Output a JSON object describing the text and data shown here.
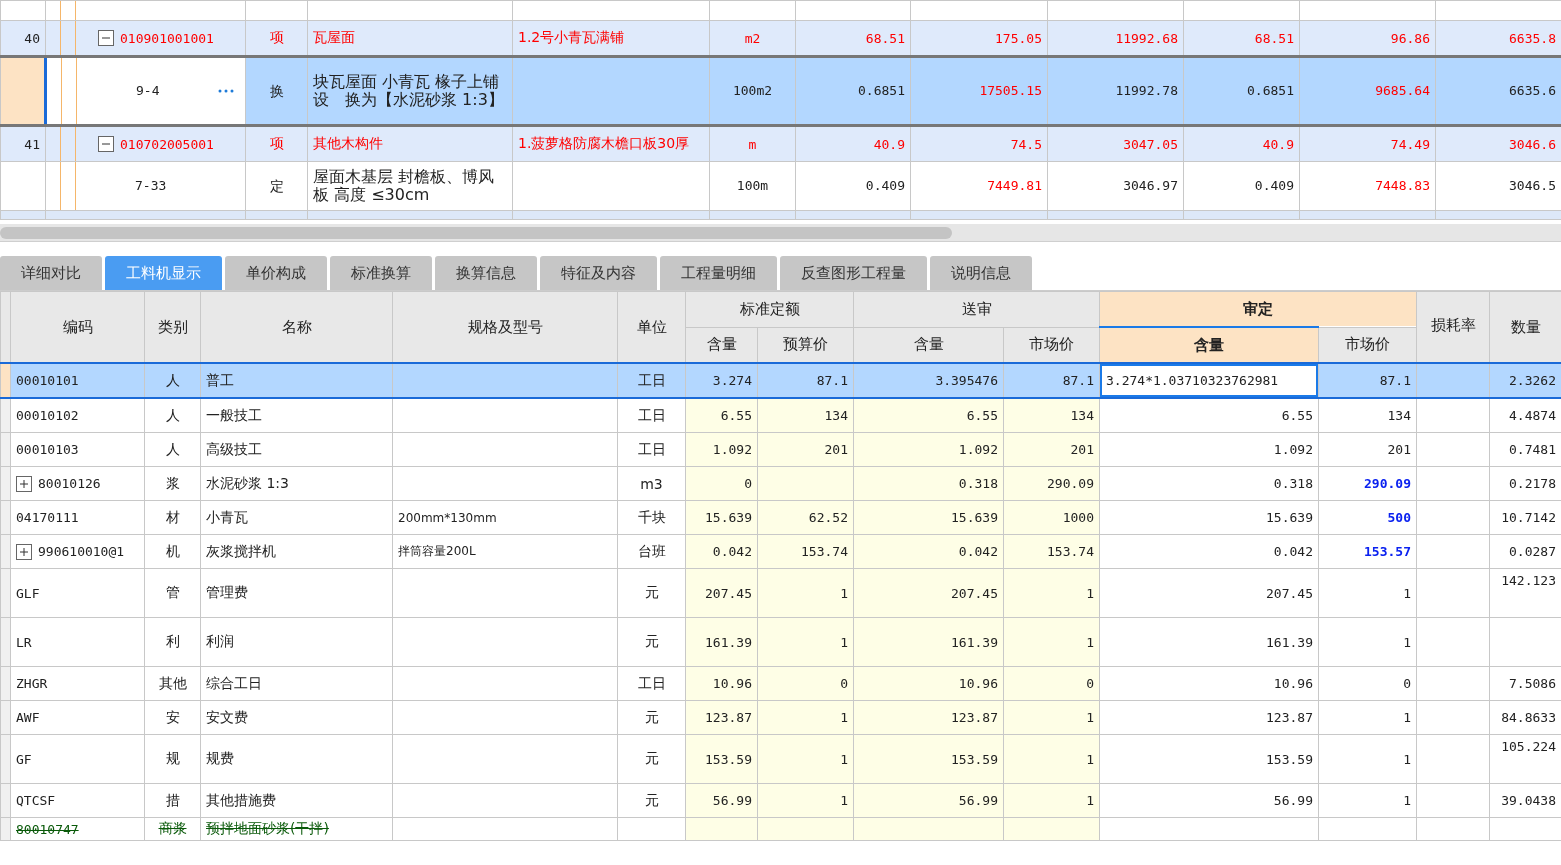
{
  "upper": {
    "rows": [
      {
        "kind": "item",
        "selected": false,
        "number": "40",
        "code": "010901001001",
        "expanded": true,
        "type": "项",
        "name": "瓦屋面",
        "feature": "1.2号小青瓦满铺",
        "unit": "m2",
        "values": [
          {
            "text": "68.51"
          },
          {
            "text": "175.05"
          },
          {
            "text": "11992.68"
          },
          {
            "text": "68.51"
          },
          {
            "text": "96.86"
          },
          {
            "text": "6635.8"
          }
        ]
      },
      {
        "kind": "quota",
        "selected": true,
        "code": "9-4",
        "type": "换",
        "name": "块瓦屋面 小青瓦 椽子上铺设　换为【水泥砂浆 1:3】",
        "unit": "100m2",
        "values": [
          {
            "text": "0.6851",
            "alert": false
          },
          {
            "text": "17505.15",
            "alert": true
          },
          {
            "text": "11992.78",
            "alert": false
          },
          {
            "text": "0.6851",
            "alert": false
          },
          {
            "text": "9685.64",
            "alert": true
          },
          {
            "text": "6635.6",
            "alert": false
          }
        ]
      },
      {
        "kind": "item",
        "selected": false,
        "number": "41",
        "code": "010702005001",
        "expanded": true,
        "type": "项",
        "name": "其他木构件",
        "feature": "1.菠萝格防腐木檐口板30厚",
        "unit": "m",
        "values": [
          {
            "text": "40.9"
          },
          {
            "text": "74.5"
          },
          {
            "text": "3047.05"
          },
          {
            "text": "40.9"
          },
          {
            "text": "74.49"
          },
          {
            "text": "3046.6"
          }
        ]
      },
      {
        "kind": "quota",
        "selected": false,
        "code": "7-33",
        "type": "定",
        "name": "屋面木基层 封檐板、博风板 高度 ≤30cm",
        "unit": "100m",
        "values": [
          {
            "text": "0.409",
            "alert": false
          },
          {
            "text": "7449.81",
            "alert": true
          },
          {
            "text": "3046.97",
            "alert": false
          },
          {
            "text": "0.409",
            "alert": false
          },
          {
            "text": "7448.83",
            "alert": true
          },
          {
            "text": "3046.5",
            "alert": false
          }
        ]
      }
    ]
  },
  "tabs": [
    {
      "label": "详细对比",
      "selected": false
    },
    {
      "label": "工料机显示",
      "selected": true
    },
    {
      "label": "单价构成",
      "selected": false
    },
    {
      "label": "标准换算",
      "selected": false
    },
    {
      "label": "换算信息",
      "selected": false
    },
    {
      "label": "特征及内容",
      "selected": false
    },
    {
      "label": "工程量明细",
      "selected": false
    },
    {
      "label": "反查图形工程量",
      "selected": false
    },
    {
      "label": "说明信息",
      "selected": false
    }
  ],
  "resources": {
    "headers": {
      "code": "编码",
      "category": "类别",
      "name": "名称",
      "spec": "规格及型号",
      "unit": "单位",
      "standard": "标准定额",
      "submitted": "送审",
      "approved": "审定",
      "std_quantity": "含量",
      "std_budget_price": "预算价",
      "sub_quantity": "含量",
      "sub_market_price": "市场价",
      "app_quantity": "含量",
      "app_market_price": "市场价",
      "loss_rate": "损耗率",
      "amount": "数量"
    },
    "rows": [
      {
        "kind": "normal",
        "selected": true,
        "code": "00010101",
        "category": "人",
        "name": "普工",
        "unit": "工日",
        "std_qty": "3.274",
        "std_price": "87.1",
        "sub_qty": "3.395476",
        "sub_price": "87.1",
        "app_qty": "3.274*1.03710323762981",
        "editing": true,
        "app_price": "87.1",
        "adjusted": false,
        "amount": "2.3262",
        "tall": false
      },
      {
        "kind": "normal",
        "selected": false,
        "code": "00010102",
        "category": "人",
        "name": "一般技工",
        "unit": "工日",
        "std_qty": "6.55",
        "std_price": "134",
        "sub_qty": "6.55",
        "sub_price": "134",
        "app_qty": "6.55",
        "editing": false,
        "app_price": "134",
        "adjusted": false,
        "amount": "4.4874",
        "tall": false
      },
      {
        "kind": "normal",
        "selected": false,
        "code": "00010103",
        "category": "人",
        "name": "高级技工",
        "unit": "工日",
        "std_qty": "1.092",
        "std_price": "201",
        "sub_qty": "1.092",
        "sub_price": "201",
        "app_qty": "1.092",
        "editing": false,
        "app_price": "201",
        "adjusted": false,
        "amount": "0.7481",
        "tall": false
      },
      {
        "kind": "normal",
        "selected": false,
        "expandable": true,
        "code": "80010126",
        "category": "浆",
        "name": "水泥砂浆 1:3",
        "unit": "m3",
        "std_qty": "0",
        "sub_qty": "0.318",
        "sub_price": "290.09",
        "app_qty": "0.318",
        "editing": false,
        "app_price": "290.09",
        "adjusted": true,
        "amount": "0.2178",
        "tall": false
      },
      {
        "kind": "normal",
        "selected": false,
        "code": "04170111",
        "category": "材",
        "name": "小青瓦",
        "spec": "200mm*130mm",
        "unit": "千块",
        "std_qty": "15.639",
        "std_price": "62.52",
        "sub_qty": "15.639",
        "sub_price": "1000",
        "app_qty": "15.639",
        "editing": false,
        "app_price": "500",
        "adjusted": true,
        "amount": "10.7142",
        "tall": false
      },
      {
        "kind": "normal",
        "selected": false,
        "expandable": true,
        "code": "990610010@1",
        "category": "机",
        "name": "灰浆搅拌机",
        "spec": "拌筒容量200L",
        "unit": "台班",
        "std_qty": "0.042",
        "std_price": "153.74",
        "sub_qty": "0.042",
        "sub_price": "153.74",
        "app_qty": "0.042",
        "editing": false,
        "app_price": "153.57",
        "adjusted": true,
        "amount": "0.0287",
        "tall": false
      },
      {
        "kind": "normal",
        "selected": false,
        "code": "GLF",
        "category": "管",
        "name": "管理费",
        "unit": "元",
        "std_qty": "207.45",
        "std_price": "1",
        "sub_qty": "207.45",
        "sub_price": "1",
        "app_qty": "207.45",
        "editing": false,
        "app_price": "1",
        "adjusted": false,
        "amount": "142.123",
        "tall": true
      },
      {
        "kind": "normal",
        "selected": false,
        "code": "LR",
        "category": "利",
        "name": "利润",
        "unit": "元",
        "std_qty": "161.39",
        "std_price": "1",
        "sub_qty": "161.39",
        "sub_price": "1",
        "app_qty": "161.39",
        "editing": false,
        "app_price": "1",
        "adjusted": false,
        "tall": true
      },
      {
        "kind": "normal",
        "selected": false,
        "code": "ZHGR",
        "category": "其他",
        "name": "综合工日",
        "unit": "工日",
        "std_qty": "10.96",
        "std_price": "0",
        "sub_qty": "10.96",
        "sub_price": "0",
        "app_qty": "10.96",
        "editing": false,
        "app_price": "0",
        "adjusted": false,
        "amount": "7.5086",
        "tall": false
      },
      {
        "kind": "normal",
        "selected": false,
        "code": "AWF",
        "category": "安",
        "name": "安文费",
        "unit": "元",
        "std_qty": "123.87",
        "std_price": "1",
        "sub_qty": "123.87",
        "sub_price": "1",
        "app_qty": "123.87",
        "editing": false,
        "app_price": "1",
        "adjusted": false,
        "amount": "84.8633",
        "tall": false
      },
      {
        "kind": "normal",
        "selected": false,
        "code": "GF",
        "category": "规",
        "name": "规费",
        "unit": "元",
        "std_qty": "153.59",
        "std_price": "1",
        "sub_qty": "153.59",
        "sub_price": "1",
        "app_qty": "153.59",
        "editing": false,
        "app_price": "1",
        "adjusted": false,
        "amount": "105.224",
        "tall": true
      },
      {
        "kind": "normal",
        "selected": false,
        "code": "QTCSF",
        "category": "措",
        "name": "其他措施费",
        "unit": "元",
        "std_qty": "56.99",
        "std_price": "1",
        "sub_qty": "56.99",
        "sub_price": "1",
        "app_qty": "56.99",
        "editing": false,
        "app_price": "1",
        "adjusted": false,
        "amount": "39.0438",
        "tall": false
      },
      {
        "kind": "deleted",
        "selected": false,
        "code": "80010747",
        "category": "商浆",
        "name": "预拌地面砂浆(干拌)",
        "editing": false,
        "tall": false
      }
    ]
  }
}
